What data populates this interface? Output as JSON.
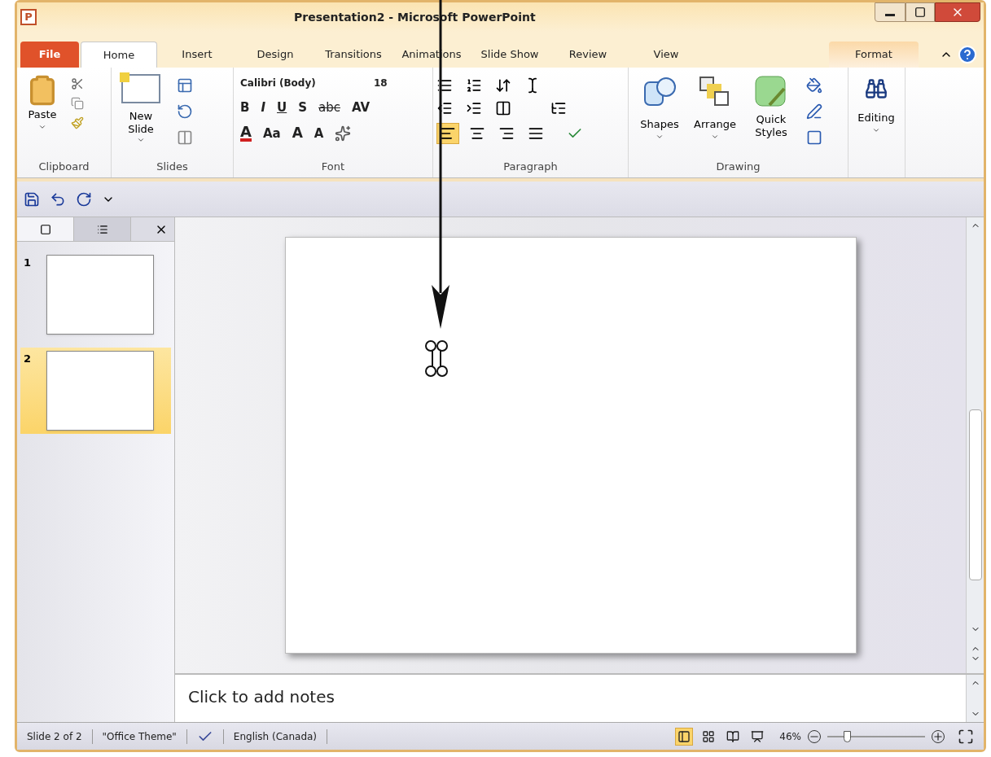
{
  "window": {
    "title": "Presentation2 - Microsoft PowerPoint",
    "app_icon": "P"
  },
  "tabs": [
    {
      "label": "File",
      "kind": "file",
      "selected": false
    },
    {
      "label": "Home",
      "kind": "normal",
      "selected": true
    },
    {
      "label": "Insert",
      "kind": "normal",
      "selected": false
    },
    {
      "label": "Design",
      "kind": "normal",
      "selected": false
    },
    {
      "label": "Transitions",
      "kind": "normal",
      "selected": false
    },
    {
      "label": "Animations",
      "kind": "normal",
      "selected": false
    },
    {
      "label": "Slide Show",
      "kind": "normal",
      "selected": false
    },
    {
      "label": "Review",
      "kind": "normal",
      "selected": false
    },
    {
      "label": "View",
      "kind": "normal",
      "selected": false
    },
    {
      "label": "Format",
      "kind": "contextual",
      "selected": false
    }
  ],
  "ribbon": {
    "clipboard": {
      "label": "Clipboard",
      "paste": "Paste"
    },
    "slides": {
      "label": "Slides",
      "new_slide": "New Slide"
    },
    "font": {
      "label": "Font",
      "font_name": "Calibri (Body)",
      "font_size": "18",
      "row1": [
        {
          "label": "B",
          "kind": "bold"
        },
        {
          "label": "I",
          "kind": "italic"
        },
        {
          "label": "U",
          "kind": "underline"
        },
        {
          "label": "S",
          "kind": "shadow"
        },
        {
          "label": "abc",
          "kind": "strike"
        },
        {
          "label": "AV",
          "kind": "spacing"
        }
      ],
      "row2": [
        {
          "label": "A",
          "kind": "color"
        },
        {
          "label": "Aa",
          "kind": "case"
        },
        {
          "label": "A",
          "kind": "grow"
        },
        {
          "label": "A",
          "kind": "shrink"
        }
      ]
    },
    "paragraph": {
      "label": "Paragraph",
      "align": [
        {
          "kind": "left",
          "selected": true
        },
        {
          "kind": "center",
          "selected": false
        },
        {
          "kind": "right",
          "selected": false
        },
        {
          "kind": "justify",
          "selected": false
        }
      ]
    },
    "drawing": {
      "label": "Drawing",
      "shapes": "Shapes",
      "arrange": "Arrange",
      "quick_styles": "Quick Styles"
    },
    "editing": {
      "label": "Editing"
    }
  },
  "slide_panel": {
    "tabs": [
      {
        "kind": "slides",
        "selected": true
      },
      {
        "kind": "outline",
        "selected": false
      }
    ],
    "thumbnails": [
      {
        "number": "1",
        "selected": false
      },
      {
        "number": "2",
        "selected": true
      }
    ]
  },
  "notes": {
    "placeholder": "Click to add notes"
  },
  "status_bar": {
    "slide": "Slide 2 of 2",
    "theme": "\"Office Theme\"",
    "language": "English (Canada)",
    "views": [
      {
        "kind": "normal",
        "selected": true
      },
      {
        "kind": "sorter",
        "selected": false
      },
      {
        "kind": "reading",
        "selected": false
      },
      {
        "kind": "slideshow",
        "selected": false
      }
    ],
    "zoom": "46%",
    "zoom_slider": {
      "level": 0.2
    }
  }
}
